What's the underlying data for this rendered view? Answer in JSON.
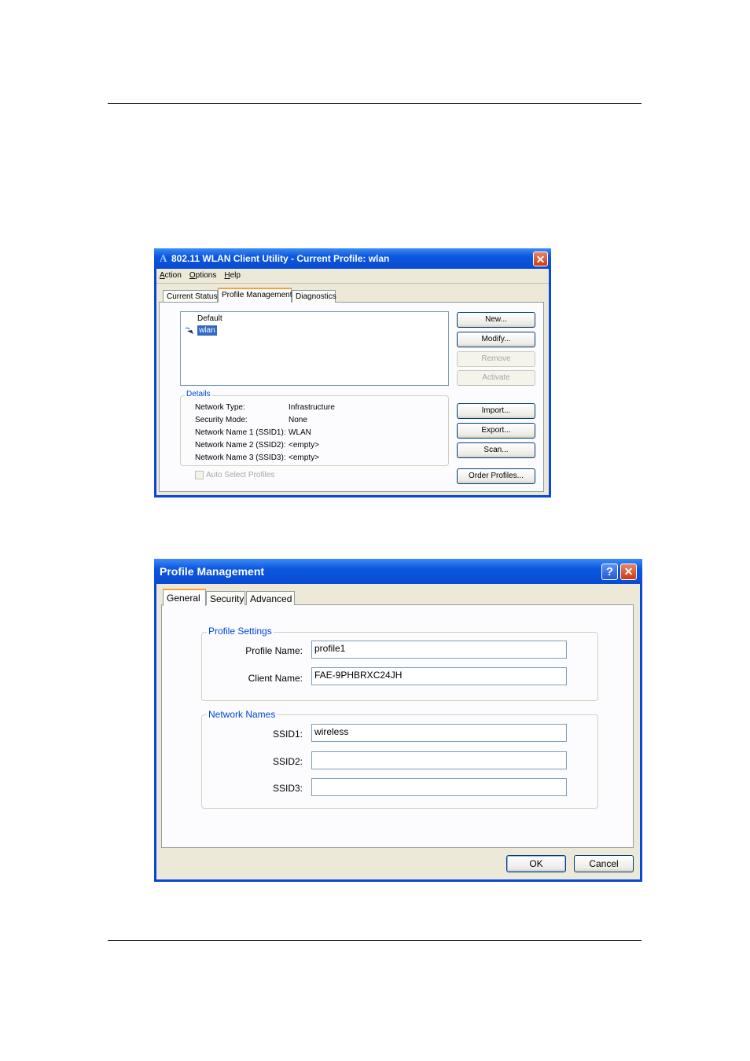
{
  "utility_window": {
    "title": "802.11 WLAN Client Utility - Current Profile: wlan",
    "logo_glyph": "A",
    "menu": [
      "Action",
      "Options",
      "Help"
    ],
    "tabs": [
      "Current Status",
      "Profile Management",
      "Diagnostics"
    ],
    "active_tab": "Profile Management",
    "profiles": [
      "Default",
      "wlan"
    ],
    "selected_profile": "wlan",
    "buttons": {
      "new": "New...",
      "modify": "Modify...",
      "remove": "Remove",
      "activate": "Activate",
      "import": "Import...",
      "export": "Export...",
      "scan": "Scan...",
      "order": "Order Profiles..."
    },
    "details": {
      "label": "Details",
      "rows": [
        {
          "label": "Network Type:",
          "value": "Infrastructure"
        },
        {
          "label": "Security Mode:",
          "value": "None"
        },
        {
          "label": "Network Name 1 (SSID1):",
          "value": "WLAN"
        },
        {
          "label": "Network Name 2 (SSID2):",
          "value": "<empty>"
        },
        {
          "label": "Network Name 3 (SSID3):",
          "value": "<empty>"
        }
      ]
    },
    "auto_select": "Auto Select Profiles"
  },
  "profile_dialog": {
    "title": "Profile Management",
    "help_glyph": "?",
    "close_glyph": "✕",
    "tabs": [
      "General",
      "Security",
      "Advanced"
    ],
    "active_tab": "General",
    "profile_settings": {
      "label": "Profile Settings",
      "profile_name_label": "Profile Name:",
      "profile_name": "profile1",
      "client_name_label": "Client Name:",
      "client_name": "FAE-9PHBRXC24JH"
    },
    "network_names": {
      "label": "Network Names",
      "ssid1_label": "SSID1:",
      "ssid1": "wireless",
      "ssid2_label": "SSID2:",
      "ssid2": "",
      "ssid3_label": "SSID3:",
      "ssid3": ""
    },
    "ok": "OK",
    "cancel": "Cancel"
  },
  "colors": {
    "title_bar": "#0a4bd1",
    "close_button": "#cc3b12",
    "selection": "#316ac5",
    "group_label": "#0046d5"
  }
}
